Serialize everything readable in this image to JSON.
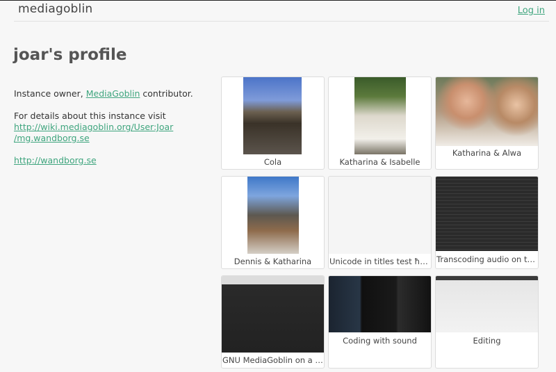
{
  "header": {
    "logo": "mediagoblin",
    "login_label": "Log in"
  },
  "profile": {
    "title": "joar's profile",
    "bio_prefix": "Instance owner, ",
    "bio_link": "MediaGoblin",
    "bio_suffix": " contributor.",
    "details_text": "For details about this instance visit",
    "details_link_line1": "http://wiki.mediagoblin.org/User:Joar",
    "details_link_line2": "/mg.wandborg.se",
    "website": "http://wandborg.se"
  },
  "gallery": {
    "items": [
      {
        "caption": "Cola"
      },
      {
        "caption": "Katharina & Isabelle"
      },
      {
        "caption": "Katharina & Alwa"
      },
      {
        "caption": "Dennis & Katharina"
      },
      {
        "caption": "Unicode in titles test ħnᵌðß..."
      },
      {
        "caption": "Transcoding audio on the R..."
      },
      {
        "caption": "GNU MediaGoblin on a Ras..."
      },
      {
        "caption": "Coding with sound"
      },
      {
        "caption": "Editing"
      }
    ]
  }
}
